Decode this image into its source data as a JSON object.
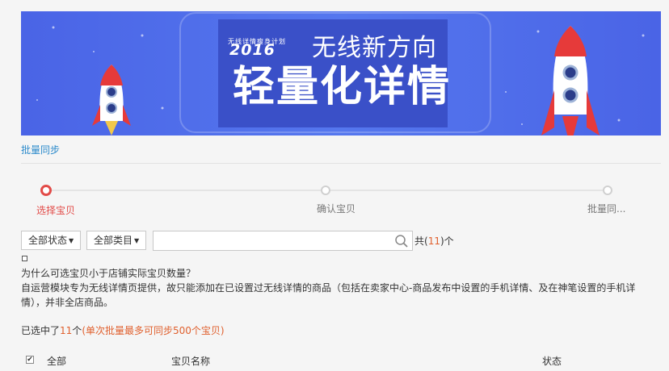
{
  "banner": {
    "plan_text": "无线详情瘦身计划",
    "year": "2016",
    "headline": "无线新方向",
    "big_title": "轻量化详情"
  },
  "breadcrumb": {
    "label": "批量同步"
  },
  "steps": [
    {
      "label": "选择宝贝",
      "active": true
    },
    {
      "label": "确认宝贝",
      "active": false
    },
    {
      "label": "批量同...",
      "active": false
    }
  ],
  "filters": {
    "status_label": "全部状态",
    "category_label": "全部类目",
    "search_value": "",
    "search_placeholder": ""
  },
  "count": {
    "prefix": "共(",
    "value": "11",
    "suffix": ")个"
  },
  "faq": {
    "question": "为什么可选宝贝小于店铺实际宝贝数量？",
    "answer": "自运营模块专为无线详情页提供，故只能添加在已设置过无线详情的商品（包括在卖家中心-商品发布中设置的手机详情、及在神笔设置的手机详情），并非全店商品。"
  },
  "selected": {
    "prefix": "已选中了",
    "count": "11",
    "unit": "个",
    "note": "(单次批量最多可同步500个宝贝)"
  },
  "table": {
    "select_all_label": "全部",
    "col_name": "宝贝名称",
    "col_status": "状态",
    "select_all_checked": true
  },
  "colors": {
    "banner_bg": "#4a64e6",
    "link": "#2b8acb",
    "active_step": "#e24b48",
    "highlight": "#e0602e"
  },
  "icons": [
    "rocket-icon",
    "search-icon",
    "caret-down-icon",
    "checkbox-icon"
  ]
}
